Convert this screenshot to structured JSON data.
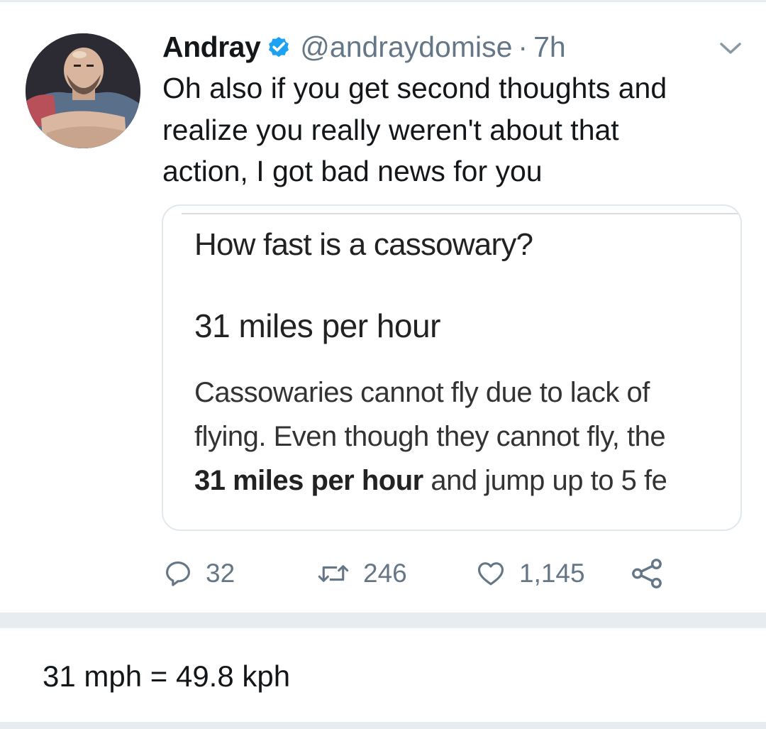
{
  "tweet": {
    "display_name": "Andray",
    "handle": "@andraydomise",
    "separator": "·",
    "time": "7h",
    "verified": true,
    "text_lines": [
      "Oh also if you get second thoughts and",
      "realize you really weren't about that",
      "action, I got bad news for you"
    ],
    "avatar_icon": "anime-character-avatar",
    "menu_icon": "chevron-down-icon",
    "colors": {
      "text": "#14171a",
      "secondary": "#657786",
      "verified": "#1da1f2",
      "border": "#e1e8ed"
    }
  },
  "quoted_card": {
    "question": "How fast is a cassowary?",
    "answer": "31 miles per hour",
    "snippet_line1": "Cassowaries cannot fly due to lack of ",
    "snippet_line2": "flying. Even though they cannot fly, the",
    "snippet_line3_bold": "31 miles per hour",
    "snippet_line3_rest": " and jump up to 5 fe"
  },
  "actions": {
    "reply_icon": "reply-icon",
    "reply_count": "32",
    "retweet_icon": "retweet-icon",
    "retweet_count": "246",
    "like_icon": "heart-icon",
    "like_count": "1,145",
    "share_icon": "share-icon"
  },
  "reply": {
    "text": "31 mph = 49.8 kph"
  }
}
